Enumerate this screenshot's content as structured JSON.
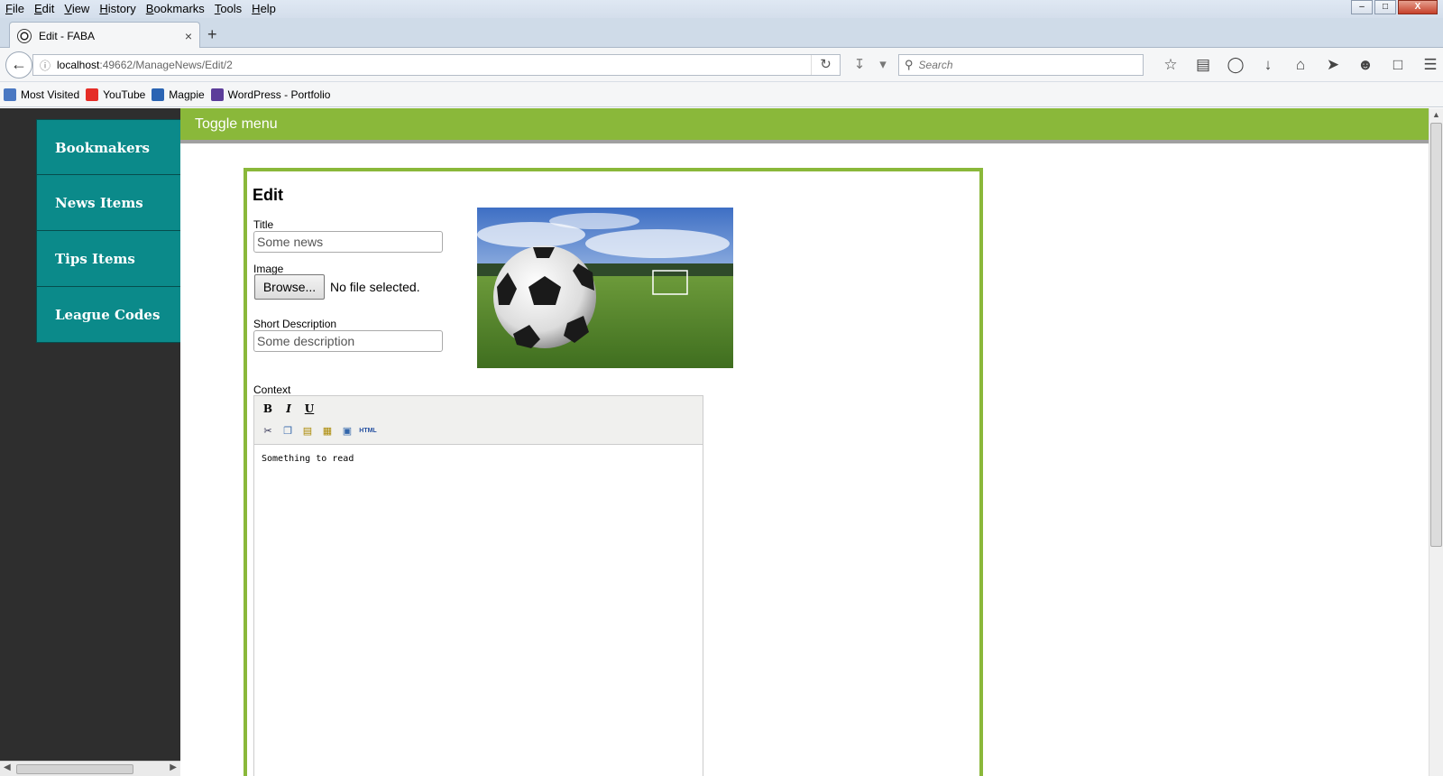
{
  "menubar": {
    "items": [
      "File",
      "Edit",
      "View",
      "History",
      "Bookmarks",
      "Tools",
      "Help"
    ]
  },
  "window_controls": {
    "minimize": "–",
    "restore": "□",
    "close": "X"
  },
  "tab": {
    "title": "Edit - FABA",
    "close": "×",
    "new_tab": "+"
  },
  "navbar": {
    "url_host": "localhost",
    "url_path": ":49662/ManageNews/Edit/2",
    "search_placeholder": "Search"
  },
  "bookmarks": [
    {
      "label": "Most Visited",
      "icon": "most-visited-icon"
    },
    {
      "label": "YouTube",
      "icon": "youtube-icon"
    },
    {
      "label": "Magpie",
      "icon": "magpie-icon"
    },
    {
      "label": "WordPress - Portfolio",
      "icon": "wordpress-icon"
    }
  ],
  "sidebar": {
    "items": [
      {
        "label": "Bookmakers"
      },
      {
        "label": "News Items"
      },
      {
        "label": "Tips Items"
      },
      {
        "label": "League Codes"
      }
    ]
  },
  "topbar": {
    "toggle_label": "Toggle menu"
  },
  "form": {
    "heading": "Edit",
    "title_label": "Title",
    "title_value": "Some news",
    "image_label": "Image",
    "browse_label": "Browse...",
    "no_file_text": "No file selected.",
    "short_desc_label": "Short Description",
    "short_desc_value": "Some description",
    "context_label": "Context",
    "context_text": "Something to read"
  },
  "editor": {
    "tools_row1": [
      "B",
      "I",
      "U"
    ],
    "tools_row2": [
      "cut-icon",
      "copy-icon",
      "paste-icon",
      "paste-text-icon",
      "paste-word-icon",
      "html-icon"
    ],
    "html_label": "HTML"
  },
  "colors": {
    "accent_green": "#8ab83a",
    "sidebar_teal": "#0b8a8a",
    "sidebar_bg": "#2e2e2e"
  }
}
